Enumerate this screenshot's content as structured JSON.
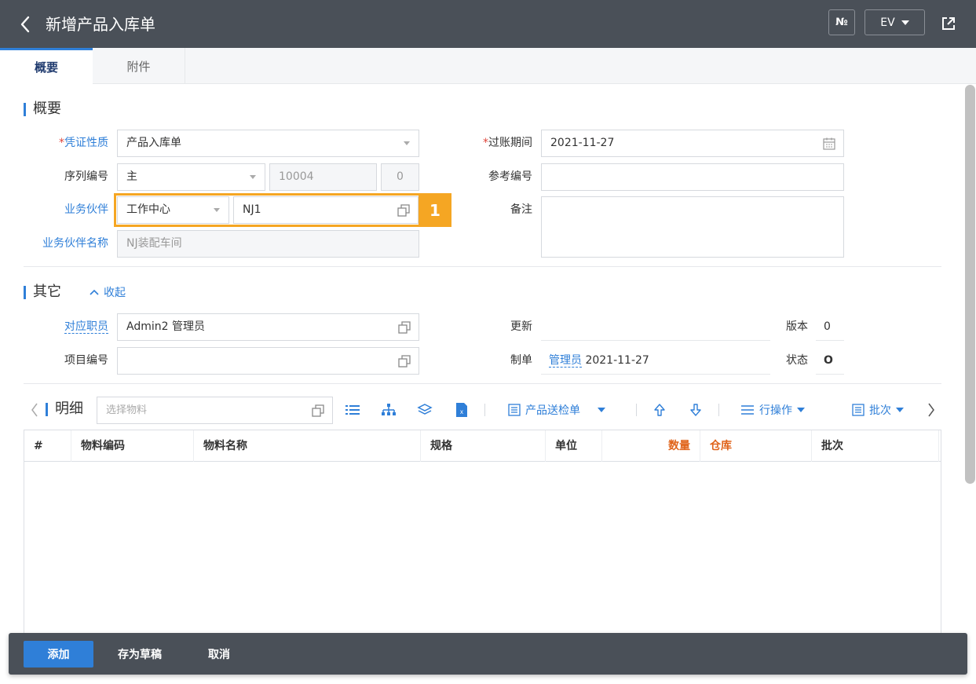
{
  "header": {
    "title": "新增产品入库单",
    "no_label": "№",
    "ev_label": "EV"
  },
  "tabs": [
    {
      "label": "概要"
    },
    {
      "label": "附件"
    }
  ],
  "summary": {
    "section_title": "概要",
    "voucher_type": {
      "label": "凭证性质",
      "required_mark": "*",
      "value": "产品入库单"
    },
    "serial": {
      "label": "序列编号",
      "type_value": "主",
      "number_placeholder": "10004",
      "suffix_placeholder": "0"
    },
    "partner": {
      "label": "业务伙伴",
      "type_value": "工作中心",
      "code_value": "NJ1"
    },
    "partner_name": {
      "label": "业务伙伴名称",
      "placeholder": "NJ装配车间"
    },
    "posting_period": {
      "label": "过账期间",
      "required_mark": "*",
      "value": "2021-11-27"
    },
    "reference_no": {
      "label": "参考编号",
      "value": ""
    },
    "remark": {
      "label": "备注",
      "value": ""
    }
  },
  "highlight": {
    "number": "1"
  },
  "other": {
    "section_title": "其它",
    "collapse_label": "收起",
    "employee": {
      "label": "对应职员",
      "value": "Admin2 管理员"
    },
    "project": {
      "label": "项目编号",
      "value": ""
    },
    "update": {
      "label": "更新",
      "value": ""
    },
    "version": {
      "label": "版本",
      "value": "0"
    },
    "creator": {
      "label": "制单",
      "user": "管理员",
      "date": "2021-11-27"
    },
    "status": {
      "label": "状态",
      "value": "O"
    }
  },
  "detail": {
    "section_title": "明细",
    "material_placeholder": "选择物料",
    "inspection_label": "产品送检单",
    "row_ops_label": "行操作",
    "batch_label": "批次",
    "columns": [
      "#",
      "物料编码",
      "物料名称",
      "规格",
      "单位",
      "数量",
      "仓库",
      "批次"
    ]
  },
  "footer": {
    "add_label": "添加",
    "draft_label": "存为草稿",
    "cancel_label": "取消"
  },
  "colors": {
    "header_bg": "#4a5058",
    "accent": "#2f7fd8",
    "highlight": "#f5a623",
    "required": "#e0463b",
    "emphasis_column": "#e0641b"
  }
}
